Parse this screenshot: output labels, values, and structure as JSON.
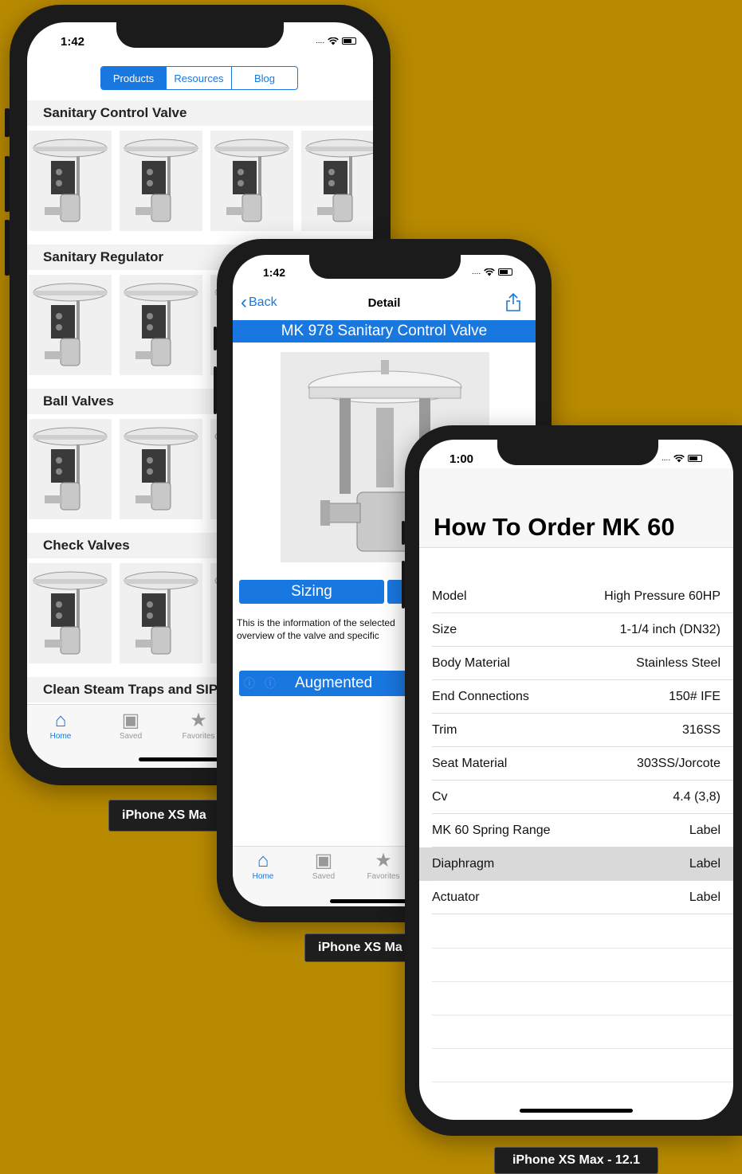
{
  "phone1": {
    "time": "1:42",
    "segments": [
      {
        "label": "Products",
        "selected": true
      },
      {
        "label": "Resources",
        "selected": false
      },
      {
        "label": "Blog",
        "selected": false
      }
    ],
    "sections": [
      {
        "title": "Sanitary Control Valve"
      },
      {
        "title": "Sanitary Regulator"
      },
      {
        "title": "Ball Valves"
      },
      {
        "title": "Check Valves"
      },
      {
        "title": "Clean Steam Traps and SIP"
      }
    ],
    "tabs": [
      {
        "label": "Home",
        "icon": "house-icon",
        "active": true
      },
      {
        "label": "Saved",
        "icon": "floppy-icon",
        "active": false
      },
      {
        "label": "Favorites",
        "icon": "star-icon",
        "active": false
      }
    ],
    "device_label": "iPhone XS Ma"
  },
  "phone2": {
    "time": "1:42",
    "back_label": "Back",
    "nav_title": "Detail",
    "product_title": "MK 978 Sanitary Control Valve",
    "sizing_label": "Sizing",
    "description": "This is the information of the selected overview of the valve and specific",
    "augmented_label": "Augmented",
    "tabs": [
      {
        "label": "Home",
        "icon": "house-icon",
        "active": true
      },
      {
        "label": "Saved",
        "icon": "floppy-icon",
        "active": false
      },
      {
        "label": "Favorites",
        "icon": "star-icon",
        "active": false
      }
    ],
    "device_label": "iPhone XS Ma"
  },
  "phone3": {
    "time": "1:00",
    "large_title": "How To Order MK 60",
    "rows": [
      {
        "label": "Model",
        "value": "High Pressure 60HP",
        "selected": false
      },
      {
        "label": "Size",
        "value": "1-1/4 inch (DN32)",
        "selected": false
      },
      {
        "label": "Body Material",
        "value": "Stainless Steel",
        "selected": false
      },
      {
        "label": "End Connections",
        "value": "150# IFE",
        "selected": false
      },
      {
        "label": "Trim",
        "value": "316SS",
        "selected": false
      },
      {
        "label": "Seat Material",
        "value": "303SS/Jorcote",
        "selected": false
      },
      {
        "label": "Cv",
        "value": "4.4 (3,8)",
        "selected": false
      },
      {
        "label": "MK 60 Spring Range",
        "value": "Label",
        "selected": false
      },
      {
        "label": "Diaphragm",
        "value": "Label",
        "selected": true
      },
      {
        "label": "Actuator",
        "value": "Label",
        "selected": false
      }
    ],
    "device_label": "iPhone XS Max - 12.1"
  },
  "colors": {
    "background": "#b88a00",
    "accent": "#1977e0",
    "selected_row": "#d9d9d9"
  }
}
